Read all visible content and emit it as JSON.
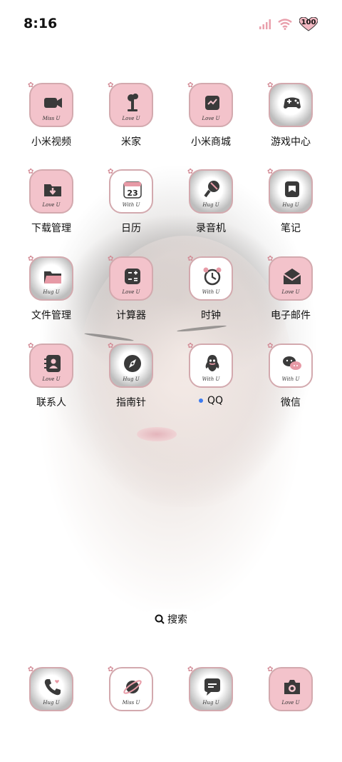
{
  "status_bar": {
    "time": "8:16",
    "battery": "100"
  },
  "apps": [
    {
      "label": "小米视频",
      "script": "Miss U",
      "style": "pink",
      "icon": "video-camera-icon"
    },
    {
      "label": "米家",
      "script": "Love U",
      "style": "pink",
      "icon": "desk-lamp-icon"
    },
    {
      "label": "小米商城",
      "script": "Love U",
      "style": "pink",
      "icon": "store-screen-icon"
    },
    {
      "label": "游戏中心",
      "script": "",
      "style": "heart",
      "icon": "gamepad-icon"
    },
    {
      "label": "下载管理",
      "script": "Love U",
      "style": "pink",
      "icon": "download-folder-icon"
    },
    {
      "label": "日历",
      "script": "With U",
      "style": "white",
      "icon": "calendar-icon",
      "date": "23"
    },
    {
      "label": "录音机",
      "script": "Hug U",
      "style": "heart",
      "icon": "microphone-icon"
    },
    {
      "label": "笔记",
      "script": "Hug U",
      "style": "heart",
      "icon": "notes-bookmark-icon"
    },
    {
      "label": "文件管理",
      "script": "Hug U",
      "style": "heart",
      "icon": "folder-icon"
    },
    {
      "label": "计算器",
      "script": "Love U",
      "style": "pink",
      "icon": "calculator-icon"
    },
    {
      "label": "时钟",
      "script": "With U",
      "style": "white",
      "icon": "alarm-clock-icon"
    },
    {
      "label": "电子邮件",
      "script": "Love U",
      "style": "pink",
      "icon": "mail-envelope-icon"
    },
    {
      "label": "联系人",
      "script": "Love U",
      "style": "pink",
      "icon": "contacts-book-icon"
    },
    {
      "label": "指南针",
      "script": "Hug U",
      "style": "heart",
      "icon": "compass-icon"
    },
    {
      "label": "QQ",
      "script": "With U",
      "style": "white",
      "icon": "qq-penguin-icon",
      "dot": true
    },
    {
      "label": "微信",
      "script": "With U",
      "style": "white",
      "icon": "wechat-icon"
    }
  ],
  "search": {
    "label": "搜索"
  },
  "dock": [
    {
      "script": "Hug U",
      "style": "heart",
      "icon": "phone-icon"
    },
    {
      "script": "Miss U",
      "style": "white",
      "icon": "planet-browser-icon"
    },
    {
      "script": "Hug U",
      "style": "heart",
      "icon": "message-bubble-icon"
    },
    {
      "script": "Love U",
      "style": "pink",
      "icon": "camera-icon"
    }
  ],
  "colors": {
    "pink": "#f3c3cb",
    "icon_dark": "#3a3a3a",
    "border": "#d3a9ae",
    "notification_dot": "#3d7bf0"
  }
}
